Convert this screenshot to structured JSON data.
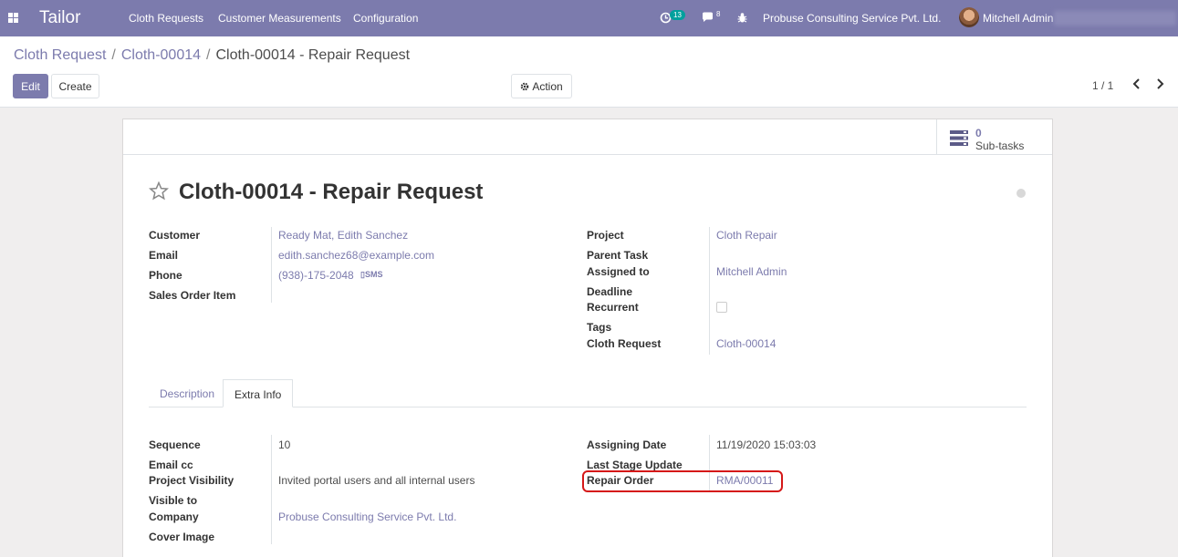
{
  "navbar": {
    "brand": "Tailor",
    "menu": [
      "Cloth Requests",
      "Customer Measurements",
      "Configuration"
    ],
    "activity_count": "13",
    "message_count": "8",
    "company": "Probuse Consulting Service Pvt. Ltd.",
    "user": "Mitchell Admin",
    "bg_color": "#7c7bad"
  },
  "breadcrumb": {
    "items": [
      "Cloth Request",
      "Cloth-00014"
    ],
    "current": "Cloth-00014 - Repair Request"
  },
  "actions": {
    "edit": "Edit",
    "create": "Create",
    "action": "Action",
    "pager": "1 / 1"
  },
  "smart_button": {
    "count": "0",
    "label": "Sub-tasks"
  },
  "record": {
    "title": "Cloth-00014 - Repair Request",
    "left": [
      {
        "label": "Customer",
        "value": "Ready Mat, Edith Sanchez"
      },
      {
        "label": "Email",
        "value": "edith.sanchez68@example.com"
      },
      {
        "label": "Phone",
        "value": "(938)-175-2048",
        "extra": "SMS"
      },
      {
        "label": "Sales Order Item",
        "value": ""
      }
    ],
    "right": [
      {
        "label": "Project",
        "value": "Cloth Repair"
      },
      {
        "label": "Parent Task",
        "value": ""
      },
      {
        "label": "Assigned to",
        "value": "Mitchell Admin"
      },
      {
        "label": "Deadline",
        "value": ""
      },
      {
        "label": "Recurrent",
        "value": ""
      },
      {
        "label": "Tags",
        "value": ""
      },
      {
        "label": "Cloth Request",
        "value": "Cloth-00014"
      }
    ]
  },
  "tabs": [
    "Description",
    "Extra Info"
  ],
  "extra_info": {
    "left": [
      {
        "label": "Sequence",
        "value": "10"
      },
      {
        "label": "Email cc",
        "value": ""
      },
      {
        "label": "Project Visibility",
        "value": "Invited portal users and all internal users"
      },
      {
        "label": "Visible to",
        "value": ""
      },
      {
        "label": "Company",
        "value": "Probuse Consulting Service Pvt. Ltd."
      },
      {
        "label": "Cover Image",
        "value": ""
      }
    ],
    "right": [
      {
        "label": "Assigning Date",
        "value": "11/19/2020 15:03:03"
      },
      {
        "label": "Last Stage Update",
        "value": ""
      },
      {
        "label": "Repair Order",
        "value": "RMA/00011"
      }
    ]
  }
}
